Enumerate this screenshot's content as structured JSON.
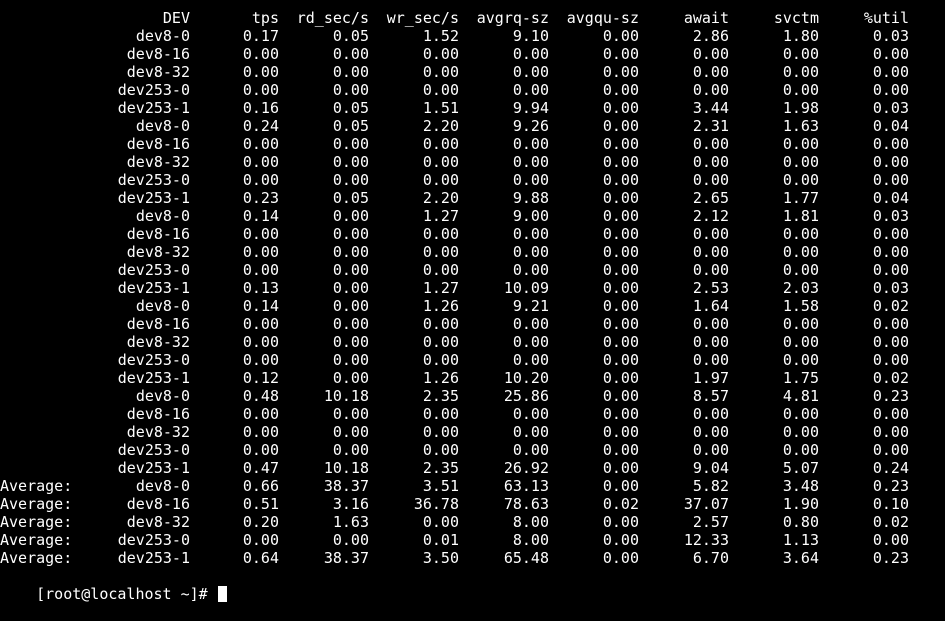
{
  "header": {
    "dev": "DEV",
    "tps": "tps",
    "rd": "rd_sec/s",
    "wr": "wr_sec/s",
    "rq": "avgrq-sz",
    "qu": "avgqu-sz",
    "aw": "await",
    "sv": "svctm",
    "ut": "%util"
  },
  "rows": [
    {
      "label": "",
      "dev": "dev8-0",
      "tps": "0.17",
      "rd": "0.05",
      "wr": "1.52",
      "rq": "9.10",
      "qu": "0.00",
      "aw": "2.86",
      "sv": "1.80",
      "ut": "0.03"
    },
    {
      "label": "",
      "dev": "dev8-16",
      "tps": "0.00",
      "rd": "0.00",
      "wr": "0.00",
      "rq": "0.00",
      "qu": "0.00",
      "aw": "0.00",
      "sv": "0.00",
      "ut": "0.00"
    },
    {
      "label": "",
      "dev": "dev8-32",
      "tps": "0.00",
      "rd": "0.00",
      "wr": "0.00",
      "rq": "0.00",
      "qu": "0.00",
      "aw": "0.00",
      "sv": "0.00",
      "ut": "0.00"
    },
    {
      "label": "",
      "dev": "dev253-0",
      "tps": "0.00",
      "rd": "0.00",
      "wr": "0.00",
      "rq": "0.00",
      "qu": "0.00",
      "aw": "0.00",
      "sv": "0.00",
      "ut": "0.00"
    },
    {
      "label": "",
      "dev": "dev253-1",
      "tps": "0.16",
      "rd": "0.05",
      "wr": "1.51",
      "rq": "9.94",
      "qu": "0.00",
      "aw": "3.44",
      "sv": "1.98",
      "ut": "0.03"
    },
    {
      "label": "",
      "dev": "dev8-0",
      "tps": "0.24",
      "rd": "0.05",
      "wr": "2.20",
      "rq": "9.26",
      "qu": "0.00",
      "aw": "2.31",
      "sv": "1.63",
      "ut": "0.04"
    },
    {
      "label": "",
      "dev": "dev8-16",
      "tps": "0.00",
      "rd": "0.00",
      "wr": "0.00",
      "rq": "0.00",
      "qu": "0.00",
      "aw": "0.00",
      "sv": "0.00",
      "ut": "0.00"
    },
    {
      "label": "",
      "dev": "dev8-32",
      "tps": "0.00",
      "rd": "0.00",
      "wr": "0.00",
      "rq": "0.00",
      "qu": "0.00",
      "aw": "0.00",
      "sv": "0.00",
      "ut": "0.00"
    },
    {
      "label": "",
      "dev": "dev253-0",
      "tps": "0.00",
      "rd": "0.00",
      "wr": "0.00",
      "rq": "0.00",
      "qu": "0.00",
      "aw": "0.00",
      "sv": "0.00",
      "ut": "0.00"
    },
    {
      "label": "",
      "dev": "dev253-1",
      "tps": "0.23",
      "rd": "0.05",
      "wr": "2.20",
      "rq": "9.88",
      "qu": "0.00",
      "aw": "2.65",
      "sv": "1.77",
      "ut": "0.04"
    },
    {
      "label": "",
      "dev": "dev8-0",
      "tps": "0.14",
      "rd": "0.00",
      "wr": "1.27",
      "rq": "9.00",
      "qu": "0.00",
      "aw": "2.12",
      "sv": "1.81",
      "ut": "0.03"
    },
    {
      "label": "",
      "dev": "dev8-16",
      "tps": "0.00",
      "rd": "0.00",
      "wr": "0.00",
      "rq": "0.00",
      "qu": "0.00",
      "aw": "0.00",
      "sv": "0.00",
      "ut": "0.00"
    },
    {
      "label": "",
      "dev": "dev8-32",
      "tps": "0.00",
      "rd": "0.00",
      "wr": "0.00",
      "rq": "0.00",
      "qu": "0.00",
      "aw": "0.00",
      "sv": "0.00",
      "ut": "0.00"
    },
    {
      "label": "",
      "dev": "dev253-0",
      "tps": "0.00",
      "rd": "0.00",
      "wr": "0.00",
      "rq": "0.00",
      "qu": "0.00",
      "aw": "0.00",
      "sv": "0.00",
      "ut": "0.00"
    },
    {
      "label": "",
      "dev": "dev253-1",
      "tps": "0.13",
      "rd": "0.00",
      "wr": "1.27",
      "rq": "10.09",
      "qu": "0.00",
      "aw": "2.53",
      "sv": "2.03",
      "ut": "0.03"
    },
    {
      "label": "",
      "dev": "dev8-0",
      "tps": "0.14",
      "rd": "0.00",
      "wr": "1.26",
      "rq": "9.21",
      "qu": "0.00",
      "aw": "1.64",
      "sv": "1.58",
      "ut": "0.02"
    },
    {
      "label": "",
      "dev": "dev8-16",
      "tps": "0.00",
      "rd": "0.00",
      "wr": "0.00",
      "rq": "0.00",
      "qu": "0.00",
      "aw": "0.00",
      "sv": "0.00",
      "ut": "0.00"
    },
    {
      "label": "",
      "dev": "dev8-32",
      "tps": "0.00",
      "rd": "0.00",
      "wr": "0.00",
      "rq": "0.00",
      "qu": "0.00",
      "aw": "0.00",
      "sv": "0.00",
      "ut": "0.00"
    },
    {
      "label": "",
      "dev": "dev253-0",
      "tps": "0.00",
      "rd": "0.00",
      "wr": "0.00",
      "rq": "0.00",
      "qu": "0.00",
      "aw": "0.00",
      "sv": "0.00",
      "ut": "0.00"
    },
    {
      "label": "",
      "dev": "dev253-1",
      "tps": "0.12",
      "rd": "0.00",
      "wr": "1.26",
      "rq": "10.20",
      "qu": "0.00",
      "aw": "1.97",
      "sv": "1.75",
      "ut": "0.02"
    },
    {
      "label": "",
      "dev": "dev8-0",
      "tps": "0.48",
      "rd": "10.18",
      "wr": "2.35",
      "rq": "25.86",
      "qu": "0.00",
      "aw": "8.57",
      "sv": "4.81",
      "ut": "0.23"
    },
    {
      "label": "",
      "dev": "dev8-16",
      "tps": "0.00",
      "rd": "0.00",
      "wr": "0.00",
      "rq": "0.00",
      "qu": "0.00",
      "aw": "0.00",
      "sv": "0.00",
      "ut": "0.00"
    },
    {
      "label": "",
      "dev": "dev8-32",
      "tps": "0.00",
      "rd": "0.00",
      "wr": "0.00",
      "rq": "0.00",
      "qu": "0.00",
      "aw": "0.00",
      "sv": "0.00",
      "ut": "0.00"
    },
    {
      "label": "",
      "dev": "dev253-0",
      "tps": "0.00",
      "rd": "0.00",
      "wr": "0.00",
      "rq": "0.00",
      "qu": "0.00",
      "aw": "0.00",
      "sv": "0.00",
      "ut": "0.00"
    },
    {
      "label": "",
      "dev": "dev253-1",
      "tps": "0.47",
      "rd": "10.18",
      "wr": "2.35",
      "rq": "26.92",
      "qu": "0.00",
      "aw": "9.04",
      "sv": "5.07",
      "ut": "0.24"
    },
    {
      "label": "Average:",
      "dev": "dev8-0",
      "tps": "0.66",
      "rd": "38.37",
      "wr": "3.51",
      "rq": "63.13",
      "qu": "0.00",
      "aw": "5.82",
      "sv": "3.48",
      "ut": "0.23"
    },
    {
      "label": "Average:",
      "dev": "dev8-16",
      "tps": "0.51",
      "rd": "3.16",
      "wr": "36.78",
      "rq": "78.63",
      "qu": "0.02",
      "aw": "37.07",
      "sv": "1.90",
      "ut": "0.10"
    },
    {
      "label": "Average:",
      "dev": "dev8-32",
      "tps": "0.20",
      "rd": "1.63",
      "wr": "0.00",
      "rq": "8.00",
      "qu": "0.00",
      "aw": "2.57",
      "sv": "0.80",
      "ut": "0.02"
    },
    {
      "label": "Average:",
      "dev": "dev253-0",
      "tps": "0.00",
      "rd": "0.00",
      "wr": "0.01",
      "rq": "8.00",
      "qu": "0.00",
      "aw": "12.33",
      "sv": "1.13",
      "ut": "0.00"
    },
    {
      "label": "Average:",
      "dev": "dev253-1",
      "tps": "0.64",
      "rd": "38.37",
      "wr": "3.50",
      "rq": "65.48",
      "qu": "0.00",
      "aw": "6.70",
      "sv": "3.64",
      "ut": "0.23"
    }
  ],
  "prompt": {
    "text": "[root@localhost ~]# "
  },
  "colors": {
    "background": "#000000",
    "foreground": "#ffffff"
  }
}
